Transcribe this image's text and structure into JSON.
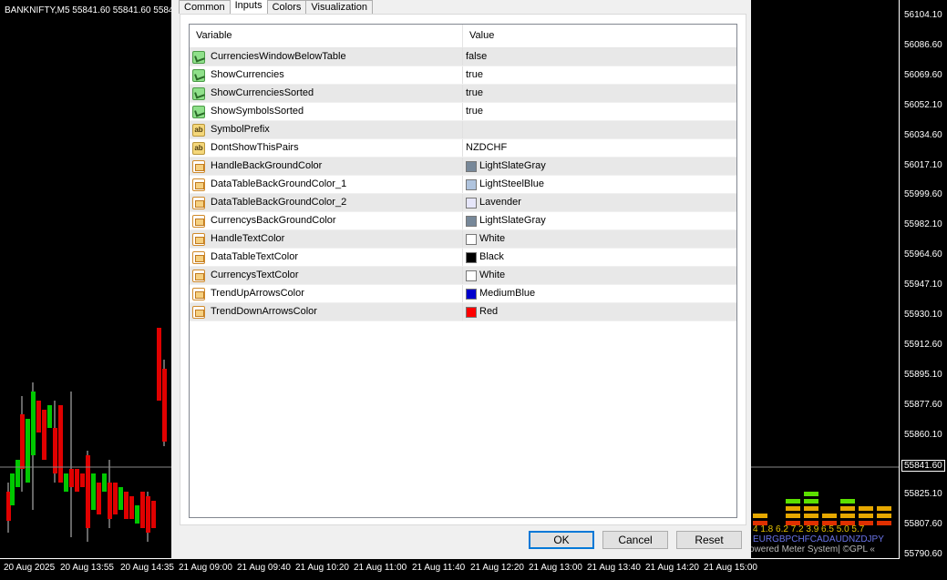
{
  "chart": {
    "title": "BANKNIFTY,M5  55841.60 55841.60 5584",
    "price_labels": [
      "56104.10",
      "56086.60",
      "56069.60",
      "56052.10",
      "56034.60",
      "56017.10",
      "55999.60",
      "55982.10",
      "55964.60",
      "55947.10",
      "55930.10",
      "55912.60",
      "55895.10",
      "55877.60",
      "55860.10",
      "55841.60",
      "55825.10",
      "55807.60",
      "55790.60"
    ],
    "current_price": "55841.60",
    "time_labels": [
      "20 Aug 2025",
      "20 Aug 13:55",
      "20 Aug 14:35",
      "21 Aug 09:00",
      "21 Aug 09:40",
      "21 Aug 10:20",
      "21 Aug 11:00",
      "21 Aug 11:40",
      "21 Aug 12:20",
      "21 Aug 13:00",
      "21 Aug 13:40",
      "21 Aug 14:20",
      "21 Aug 15:00"
    ],
    "indicator_values": "4  1.8  6.2  7.2  3.9  6.5  5.0  5.7",
    "indicator_currencies": "EURGBPCHFCADAUDNZDJPY",
    "indicator_caption": "owered Meter System| ©GPL «",
    "colors": {
      "bull": "#00c800",
      "bear": "#e00000",
      "bg": "#000000",
      "fg": "#ffffff"
    }
  },
  "dialog": {
    "tabs": [
      "Common",
      "Inputs",
      "Colors",
      "Visualization"
    ],
    "active_tab": "Inputs",
    "columns": {
      "variable": "Variable",
      "value": "Value"
    },
    "rows": [
      {
        "name": "CurrenciesWindowBelowTable",
        "value": "false",
        "type": "bool-icon"
      },
      {
        "name": "ShowCurrencies",
        "value": "true",
        "type": "bool-icon"
      },
      {
        "name": "ShowCurrenciesSorted",
        "value": "true",
        "type": "bool-icon"
      },
      {
        "name": "ShowSymbolsSorted",
        "value": "true",
        "type": "bool-icon"
      },
      {
        "name": "SymbolPrefix",
        "value": "",
        "type": "text-icon"
      },
      {
        "name": "DontShowThisPairs",
        "value": "NZDCHF",
        "type": "text-icon"
      },
      {
        "name": "HandleBackGroundColor",
        "value": "LightSlateGray",
        "type": "color-icon",
        "swatch": "#778899"
      },
      {
        "name": "DataTableBackGroundColor_1",
        "value": "LightSteelBlue",
        "type": "color-icon",
        "swatch": "#b0c4de"
      },
      {
        "name": "DataTableBackGroundColor_2",
        "value": "Lavender",
        "type": "color-icon",
        "swatch": "#e6e6fa"
      },
      {
        "name": "CurrencysBackGroundColor",
        "value": "LightSlateGray",
        "type": "color-icon",
        "swatch": "#778899"
      },
      {
        "name": "HandleTextColor",
        "value": "White",
        "type": "color-icon",
        "swatch": "#ffffff"
      },
      {
        "name": "DataTableTextColor",
        "value": "Black",
        "type": "color-icon",
        "swatch": "#000000"
      },
      {
        "name": "CurrencysTextColor",
        "value": "White",
        "type": "color-icon",
        "swatch": "#ffffff"
      },
      {
        "name": "TrendUpArrowsColor",
        "value": "MediumBlue",
        "type": "color-icon",
        "swatch": "#0000cd"
      },
      {
        "name": "TrendDownArrowsColor",
        "value": "Red",
        "type": "color-icon",
        "swatch": "#ff0000"
      }
    ],
    "buttons": {
      "ok": "OK",
      "cancel": "Cancel",
      "reset": "Reset"
    },
    "accent": "#0078d7"
  }
}
